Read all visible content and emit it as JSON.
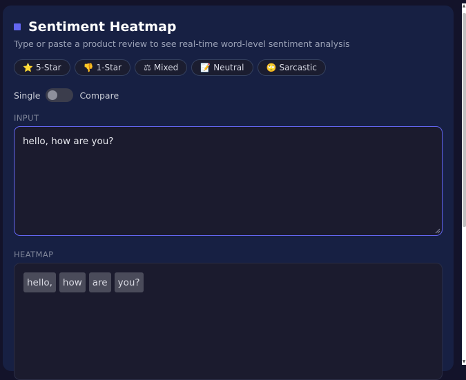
{
  "header": {
    "title": "Sentiment Heatmap",
    "subtitle": "Type or paste a product review to see real-time word-level sentiment analysis"
  },
  "presets": [
    {
      "icon": "⭐",
      "label": "5-Star"
    },
    {
      "icon": "👎",
      "label": "1-Star"
    },
    {
      "icon": "⚖",
      "label": "Mixed"
    },
    {
      "icon": "📝",
      "label": "Neutral"
    },
    {
      "icon": "🙄",
      "label": "Sarcastic"
    }
  ],
  "mode": {
    "left_label": "Single",
    "right_label": "Compare",
    "compare_enabled": false
  },
  "input": {
    "label": "INPUT",
    "value": "hello, how are you?"
  },
  "heatmap": {
    "label": "HEATMAP",
    "tokens": [
      "hello,",
      "how",
      "are",
      "you?"
    ]
  },
  "colors": {
    "accent": "#6366f1",
    "panel": "#172043",
    "token_neutral": "#4a4b5a"
  }
}
